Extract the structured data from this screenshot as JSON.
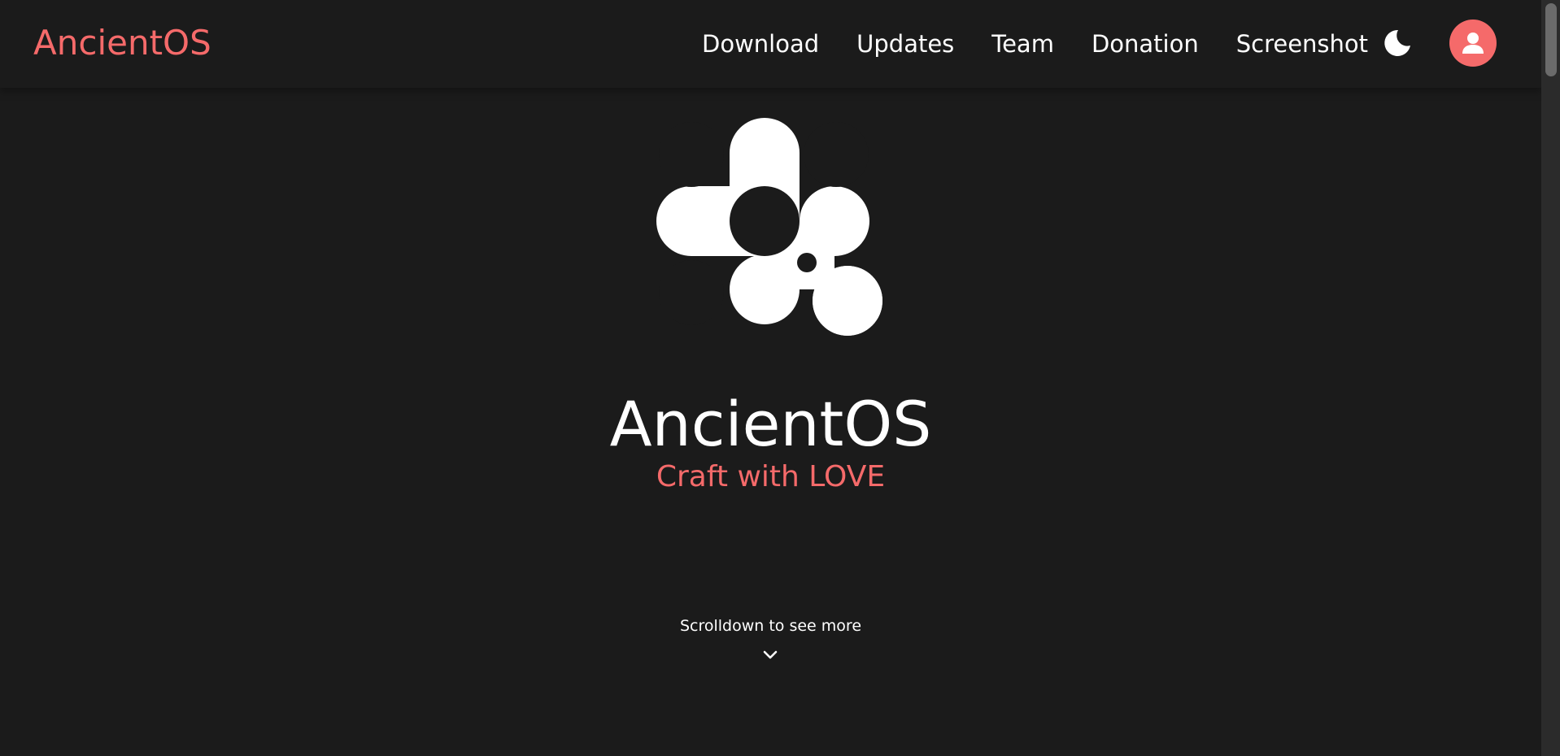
{
  "header": {
    "brand": "AncientOS",
    "nav": [
      {
        "label": "Download"
      },
      {
        "label": "Updates"
      },
      {
        "label": "Team"
      },
      {
        "label": "Donation"
      },
      {
        "label": "Screenshot"
      }
    ],
    "theme_toggle_icon": "moon-icon",
    "avatar_icon": "user-icon"
  },
  "hero": {
    "logo_icon": "ancientos-logo",
    "title": "AncientOS",
    "subtitle": "Craft with LOVE",
    "scroll_hint": "Scrolldown to see more",
    "scroll_icon": "chevron-down-icon"
  },
  "colors": {
    "background": "#1b1b1b",
    "accent": "#f56a6a",
    "text": "#ffffff"
  }
}
